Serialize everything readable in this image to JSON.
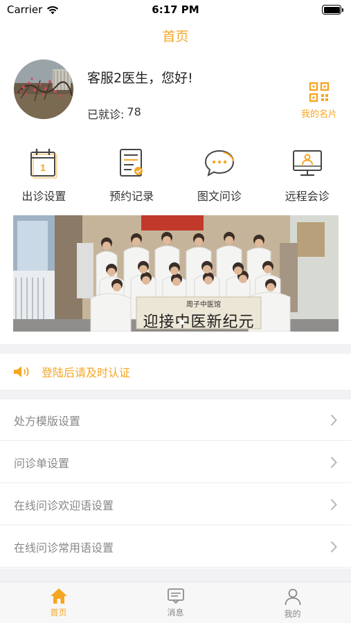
{
  "status_bar": {
    "carrier": "Carrier",
    "time": "6:17 PM"
  },
  "nav": {
    "title": "首页"
  },
  "profile": {
    "greeting": "客服2医生，您好!",
    "visited_label": "已就诊:",
    "visited_count": "78",
    "card_label": "我的名片"
  },
  "quick_actions": [
    {
      "label": "出诊设置",
      "icon": "calendar-icon"
    },
    {
      "label": "预约记录",
      "icon": "clipboard-icon"
    },
    {
      "label": "图文问诊",
      "icon": "chat-bubble-icon"
    },
    {
      "label": "远程会诊",
      "icon": "video-monitor-icon"
    }
  ],
  "banner": {
    "calligraphy": "迎接中医新纪元",
    "calligraphy_header": "周子中医馆"
  },
  "notice": {
    "text": "登陆后请及时认证",
    "icon": "speaker-icon"
  },
  "menu": [
    {
      "label": "处方模版设置"
    },
    {
      "label": "问诊单设置"
    },
    {
      "label": "在线问诊欢迎语设置"
    },
    {
      "label": "在线问诊常用语设置"
    }
  ],
  "tabs": [
    {
      "label": "首页",
      "icon": "home-icon",
      "active": true
    },
    {
      "label": "消息",
      "icon": "message-icon",
      "active": false
    },
    {
      "label": "我的",
      "icon": "user-icon",
      "active": false
    }
  ],
  "colors": {
    "accent": "#f5a623",
    "inactive": "#888888",
    "background_strip": "#f2f2f4"
  }
}
